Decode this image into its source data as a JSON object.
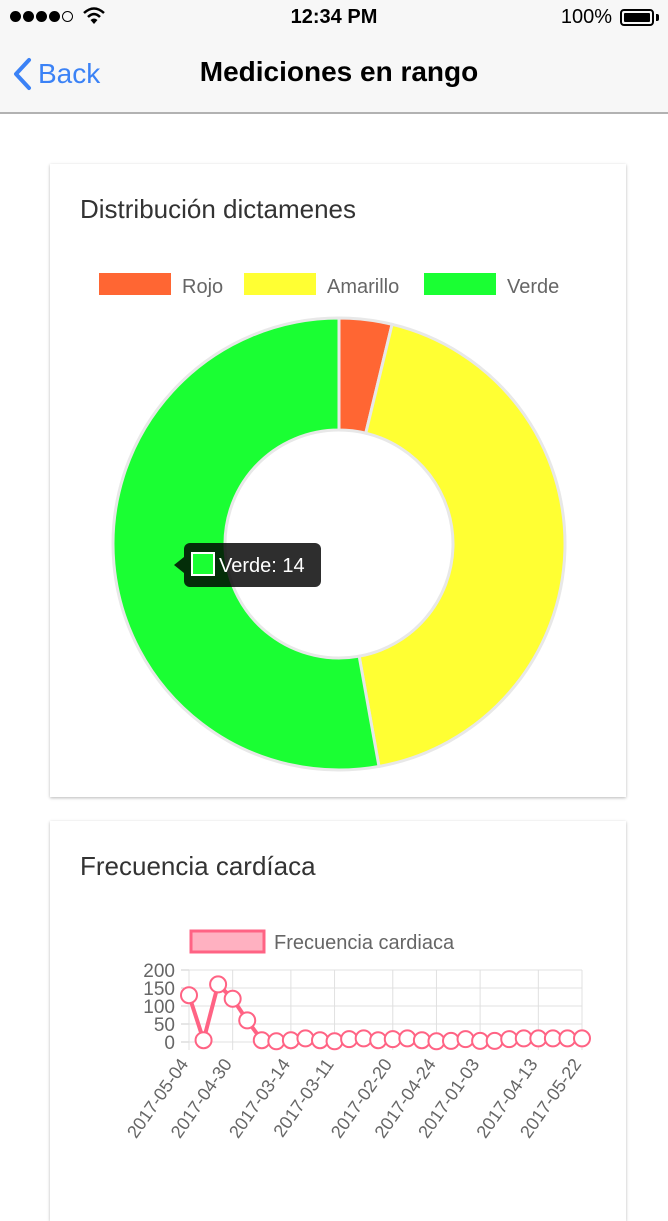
{
  "status_bar": {
    "time": "12:34 PM",
    "battery": "100%"
  },
  "nav": {
    "back_label": "Back",
    "title": "Mediciones en rango"
  },
  "cards": [
    {
      "title": "Distribución dictamenes",
      "tooltip": "Verde: 14",
      "colors": {
        "Rojo": "#ff6633",
        "Amarillo": "#ffff33",
        "Verde": "#1aff33"
      }
    },
    {
      "title": "Frecuencia cardíaca",
      "line_color": "#ff6384",
      "fill_color": "#ffb1c1"
    }
  ],
  "chart_data": [
    {
      "type": "pie",
      "style": "doughnut",
      "labels": [
        "Rojo",
        "Amarillo",
        "Verde"
      ],
      "values": [
        1,
        11.5,
        14
      ],
      "legend": "top"
    },
    {
      "type": "line",
      "series": [
        {
          "name": "Frecuencia cardiaca",
          "values": [
            130,
            5,
            160,
            120,
            60,
            5,
            2,
            5,
            10,
            5,
            2,
            8,
            10,
            5,
            8,
            10,
            5,
            2,
            3,
            8,
            3,
            3,
            8,
            10,
            10,
            10,
            10,
            10
          ]
        }
      ],
      "x_tick_labels": [
        "2017-05-04",
        "2017-04-30",
        "2017-03-14",
        "2017-03-11",
        "2017-02-20",
        "2017-04-24",
        "2017-01-03",
        "2017-04-13",
        "2017-05-22"
      ],
      "yticks": [
        0,
        50,
        100,
        150,
        200
      ],
      "ylim": [
        0,
        200
      ],
      "grid": true,
      "legend": "top"
    }
  ]
}
